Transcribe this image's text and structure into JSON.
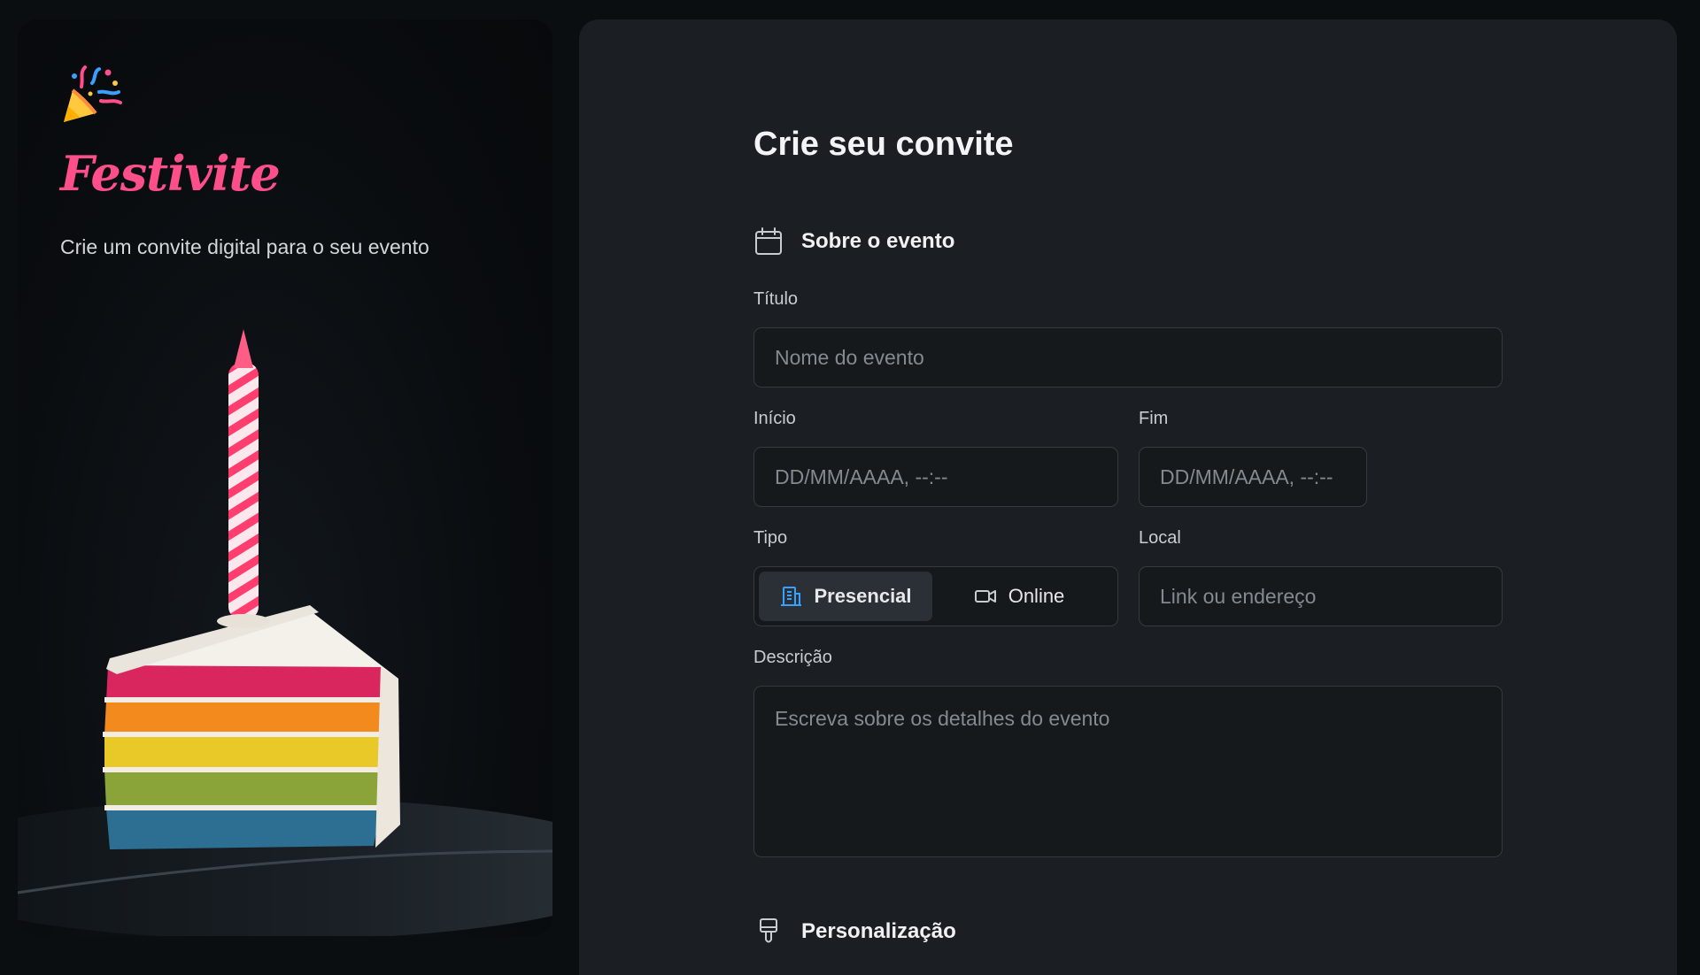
{
  "brand": {
    "name": "Festivite",
    "tagline": "Crie um convite digital para o seu evento",
    "logo_icon": "party-popper-icon",
    "accent_color": "#ff4f8b"
  },
  "hero": {
    "image": "rainbow-cake-slice-with-candle"
  },
  "form": {
    "title": "Crie seu convite",
    "sections": {
      "about": {
        "label": "Sobre o evento",
        "icon": "calendar-icon"
      },
      "personalization": {
        "label": "Personalização",
        "icon": "paint-brush-icon"
      }
    },
    "fields": {
      "title": {
        "label": "Título",
        "placeholder": "Nome do evento",
        "value": ""
      },
      "start": {
        "label": "Início",
        "placeholder": "DD/MM/AAAA, --:--",
        "value": ""
      },
      "end": {
        "label": "Fim",
        "placeholder": "DD/MM/AAAA, --:--",
        "value": ""
      },
      "type": {
        "label": "Tipo",
        "options": [
          {
            "label": "Presencial",
            "icon": "building-icon",
            "selected": true
          },
          {
            "label": "Online",
            "icon": "video-camera-icon",
            "selected": false
          }
        ]
      },
      "location": {
        "label": "Local",
        "placeholder": "Link ou endereço",
        "value": ""
      },
      "description": {
        "label": "Descrição",
        "placeholder": "Escreva sobre os detalhes do evento",
        "value": ""
      }
    }
  },
  "colors": {
    "background": "#0b0e11",
    "panel": "#1b1f23",
    "input_bg": "#15191c",
    "input_border": "#343a40",
    "active_segment": "#2a3036",
    "building_icon": "#3aa0ff"
  }
}
